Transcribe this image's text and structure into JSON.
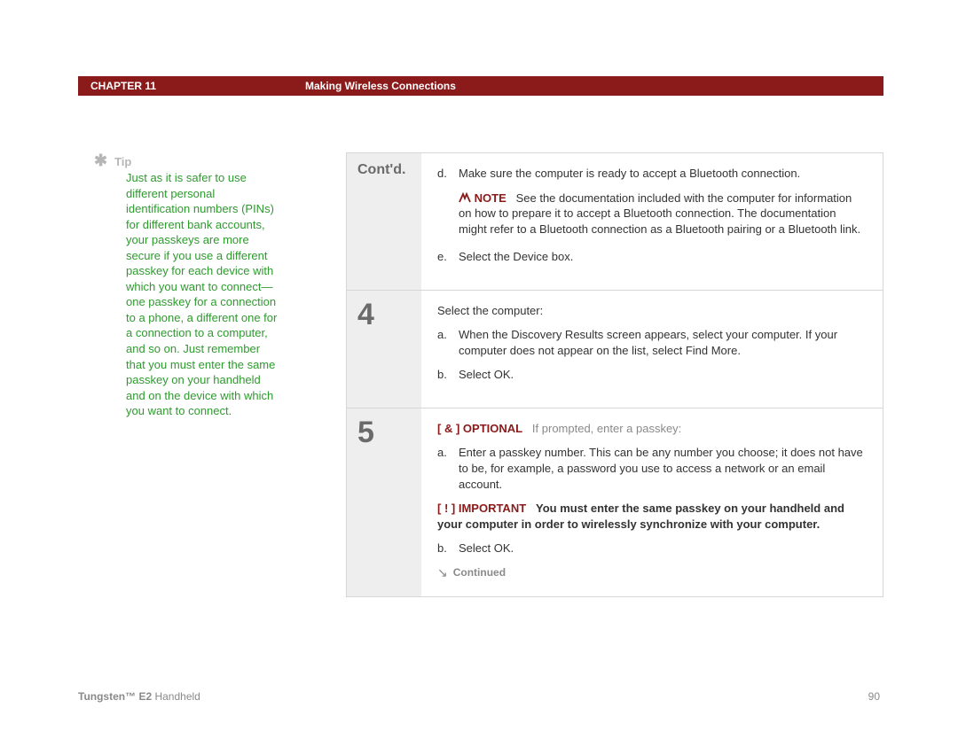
{
  "header": {
    "chapter_label": "CHAPTER 11",
    "chapter_title": "Making Wireless Connections"
  },
  "tip": {
    "label": "Tip",
    "body": "Just as it is safer to use different personal identification numbers (PINs) for different bank accounts, your passkeys are more secure if you use a different passkey for each device with which you want to connect—one passkey for a connection to a phone, a different one for a connection to a computer, and so on. Just remember that you must enter the same passkey on your handheld and on the device with which you want to connect."
  },
  "steps": {
    "contd_label": "Cont'd.",
    "contd_items_d": "Make sure the computer is ready to accept a Bluetooth connection.",
    "note_label": "NOTE",
    "note_body": "See the documentation included with the computer for information on how to prepare it to accept a Bluetooth connection. The documentation might refer to a Bluetooth connection as a Bluetooth pairing or a Bluetooth link.",
    "contd_items_e": "Select the Device box.",
    "step4_num": "4",
    "step4_intro": "Select the computer:",
    "step4_a": "When the Discovery Results screen appears, select your computer. If your computer does not appear on the list, select Find More.",
    "step4_b": "Select OK.",
    "step5_num": "5",
    "step5_optional_bracket": "[ & ]",
    "step5_optional_word": "OPTIONAL",
    "step5_optional_rest": "If prompted, enter a passkey:",
    "step5_a": "Enter a passkey number. This can be any number you choose; it does not have to be, for example, a password you use to access a network or an email account.",
    "step5_important_bracket": "[ ! ]",
    "step5_important_word": "IMPORTANT",
    "step5_important_body": "You must enter the same passkey on your handheld and your computer in order to wirelessly synchronize with your computer.",
    "step5_b": "Select OK.",
    "continued_label": "Continued"
  },
  "footer": {
    "brand_bold": "Tungsten™ E2",
    "brand_rest": " Handheld",
    "page_number": "90"
  }
}
